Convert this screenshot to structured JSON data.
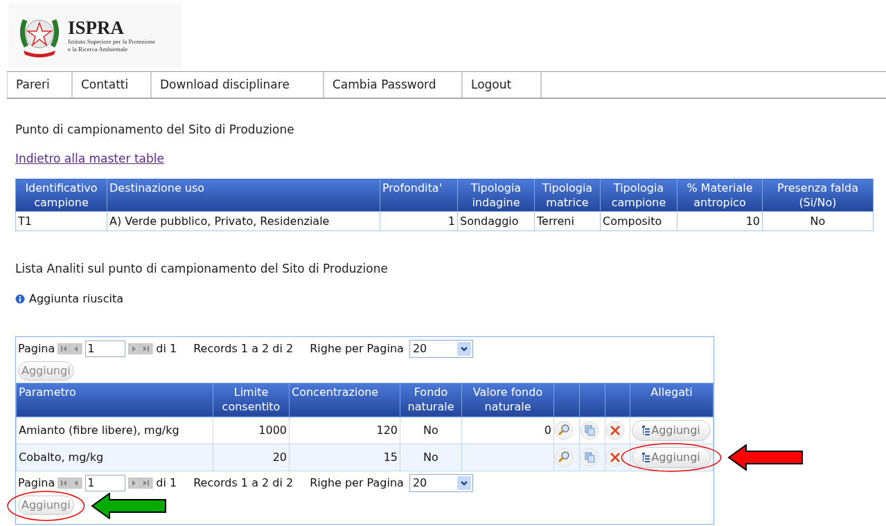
{
  "logo": {
    "title": "ISPRA",
    "subtitle_lines": [
      "Istituto Superiore per la Protezione",
      "e la Ricerca Ambientale"
    ]
  },
  "nav": [
    {
      "label": "Pareri"
    },
    {
      "label": "Contatti"
    },
    {
      "label": "Download disciplinare"
    },
    {
      "label": "Cambia Password"
    },
    {
      "label": "Logout"
    }
  ],
  "page_title": "Punto di campionamento del Sito di Produzione",
  "back_link": "Indietro alla master table",
  "sample_table": {
    "columns": [
      "Identificativo campione",
      "Destinazione uso",
      "Profondita'",
      "Tipologia indagine",
      "Tipologia matrice",
      "Tipologia campione",
      "% Materiale antropico",
      "Presenza falda (Si/No)"
    ],
    "rows": [
      [
        "T1",
        "A) Verde pubblico, Privato, Residenziale",
        "1",
        "Sondaggio",
        "Terreni",
        "Composito",
        "10",
        "No"
      ]
    ]
  },
  "analytes_title": "Lista Analiti sul punto di campionamento del Sito di Produzione",
  "message": "Aggiunta riuscita",
  "analytes": {
    "pagers": [
      {
        "label": "Pagina",
        "page": "1",
        "of": "di 1",
        "records": "Records 1 a 2 di 2",
        "rows_label": "Righe per Pagina",
        "rows_value": "20",
        "add_button": "Aggiungi"
      },
      {
        "label": "Pagina",
        "page": "1",
        "of": "di 1",
        "records": "Records 1 a 2 di 2",
        "rows_label": "Righe per Pagina",
        "rows_value": "20",
        "add_button": "Aggiungi"
      }
    ],
    "columns": [
      "Parametro",
      "Limite consentito",
      "Concentrazione",
      "Fondo naturale",
      "Valore fondo naturale"
    ],
    "attachments_column": "Allegati",
    "rows": [
      {
        "cells": [
          "Amianto (fibre libere), mg/kg",
          "1000",
          "120",
          "No",
          "0"
        ],
        "attach_button": "Aggiungi"
      },
      {
        "cells": [
          "Cobalto, mg/kg",
          "20",
          "15",
          "No",
          null
        ],
        "attach_button": "Aggiungi"
      }
    ]
  }
}
